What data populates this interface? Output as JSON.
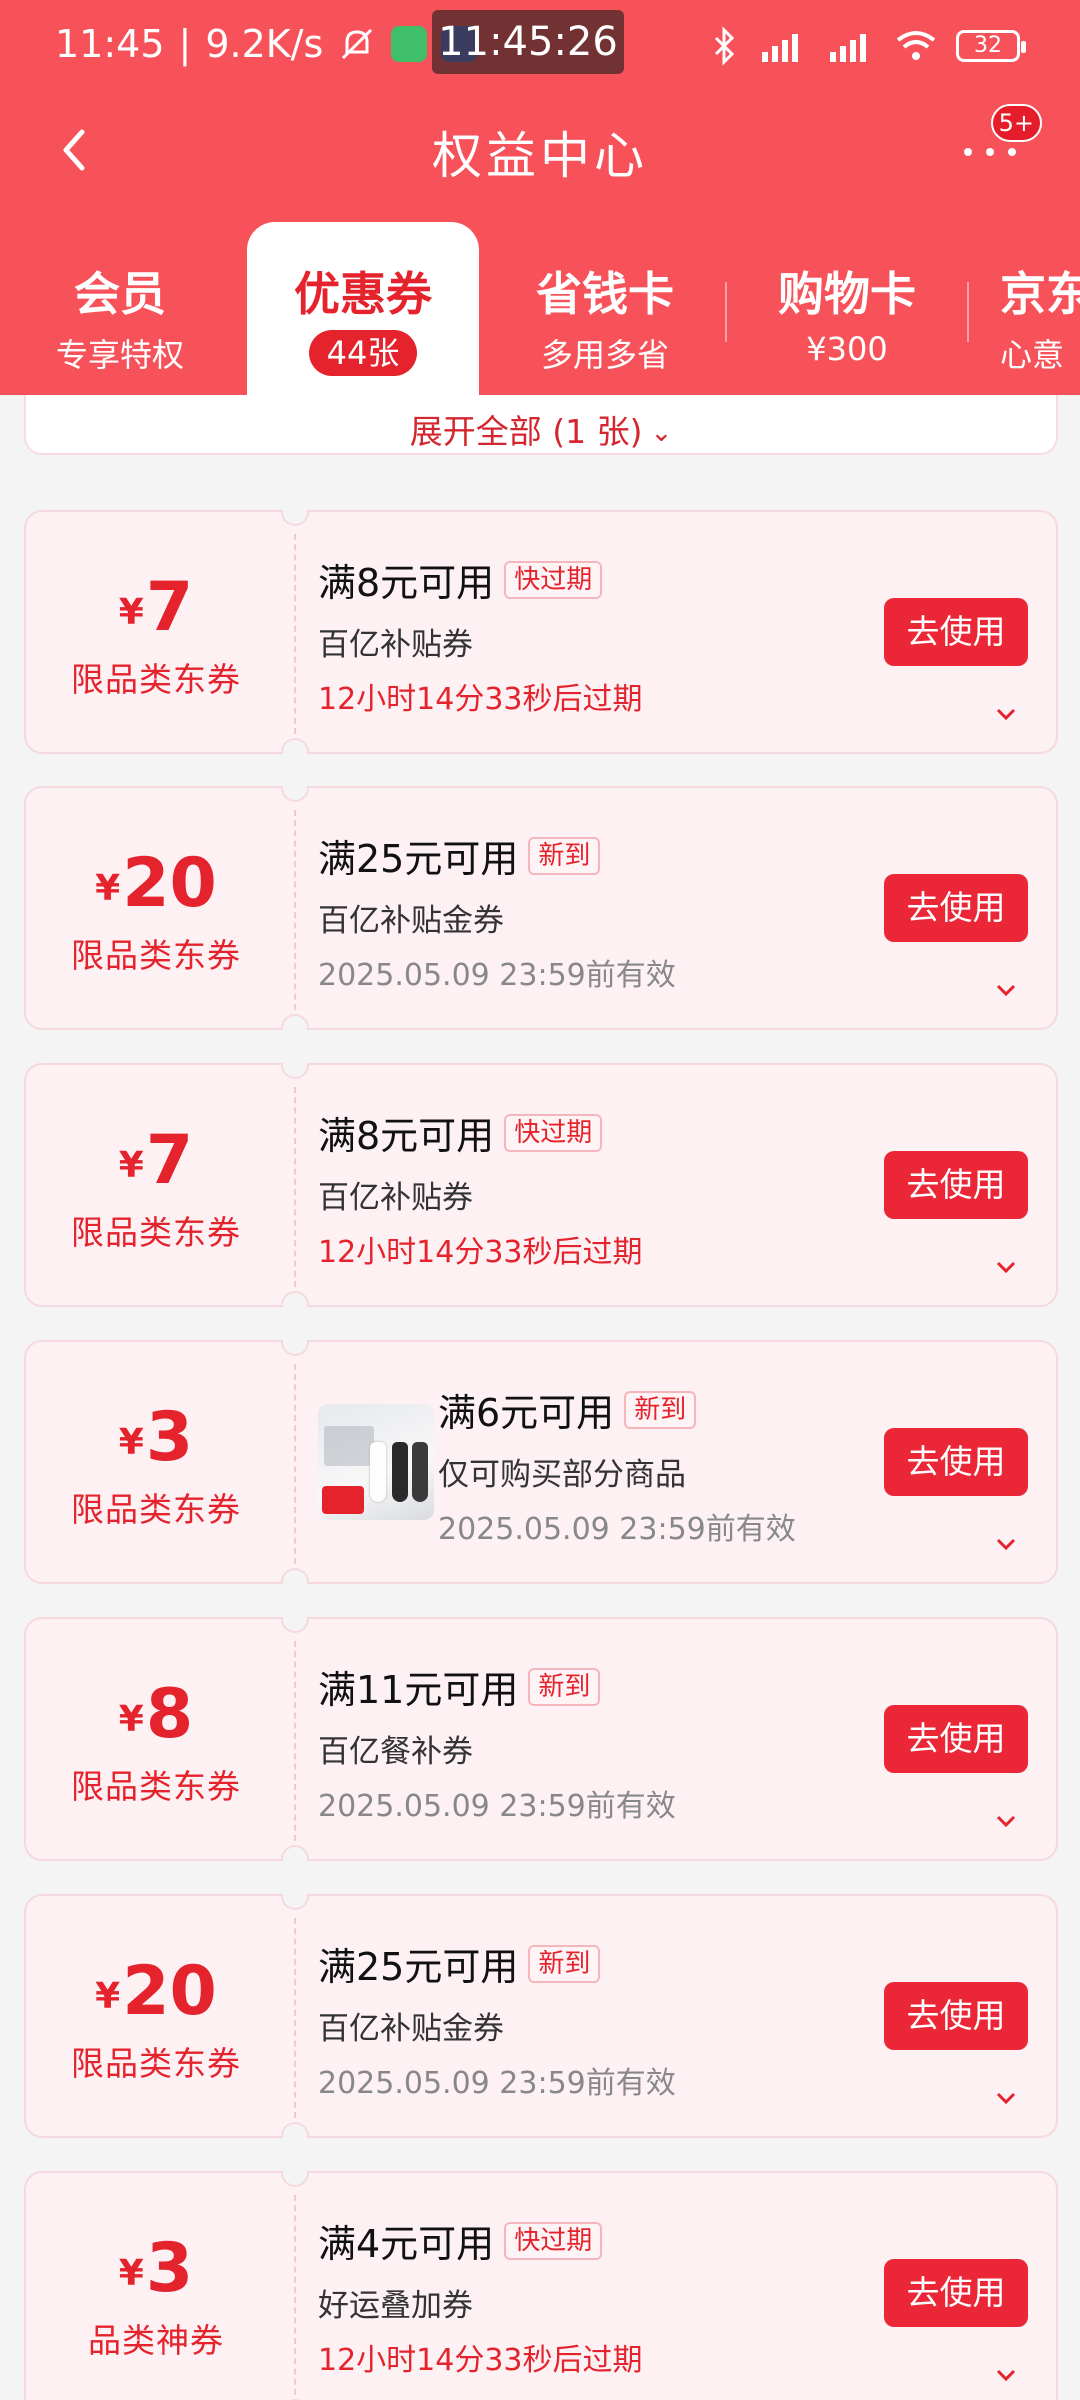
{
  "status_bar": {
    "time": "11:45",
    "speed": "9.2K/s",
    "clock_overlay": "11:45:26",
    "battery": "32",
    "icons": [
      "mute-icon",
      "app-icon",
      "alipay-icon",
      "bluetooth-icon",
      "signal-hd-icon",
      "wifi-icon"
    ]
  },
  "nav": {
    "title": "权益中心",
    "more_badge": "5+"
  },
  "tabs": [
    {
      "title": "会员",
      "sub": "专享特权"
    },
    {
      "title": "优惠券",
      "sub": "44张"
    },
    {
      "title": "省钱卡",
      "sub": "多用多省"
    },
    {
      "title": "购物卡",
      "sub": "¥300"
    },
    {
      "title": "京东",
      "sub": "心意"
    }
  ],
  "expand": {
    "label": "展开全部 (1 张)"
  },
  "coupons": [
    {
      "yen": "¥",
      "amount": "7",
      "type": "限品类东券",
      "condition": "满8元可用",
      "tag": "快过期",
      "desc": "百亿补贴券",
      "expiry": "12小时14分33秒后过期",
      "button": "去使用"
    },
    {
      "yen": "¥",
      "amount": "20",
      "type": "限品类东券",
      "condition": "满25元可用",
      "tag": "新到",
      "desc": "百亿补贴金券",
      "expiry": "2025.05.09 23:59前有效",
      "button": "去使用"
    },
    {
      "yen": "¥",
      "amount": "7",
      "type": "限品类东券",
      "condition": "满8元可用",
      "tag": "快过期",
      "desc": "百亿补贴券",
      "expiry": "12小时14分33秒后过期",
      "button": "去使用"
    },
    {
      "yen": "¥",
      "amount": "3",
      "type": "限品类东券",
      "condition": "满6元可用",
      "tag": "新到",
      "desc": "仅可购买部分商品",
      "expiry": "2025.05.09 23:59前有效",
      "button": "去使用"
    },
    {
      "yen": "¥",
      "amount": "8",
      "type": "限品类东券",
      "condition": "满11元可用",
      "tag": "新到",
      "desc": "百亿餐补券",
      "expiry": "2025.05.09 23:59前有效",
      "button": "去使用"
    },
    {
      "yen": "¥",
      "amount": "20",
      "type": "限品类东券",
      "condition": "满25元可用",
      "tag": "新到",
      "desc": "百亿补贴金券",
      "expiry": "2025.05.09 23:59前有效",
      "button": "去使用"
    },
    {
      "yen": "¥",
      "amount": "3",
      "type": "品类神券",
      "condition": "满4元可用",
      "tag": "快过期",
      "desc": "好运叠加券",
      "expiry": "12小时14分33秒后过期",
      "button": "去使用"
    }
  ],
  "colors": {
    "brand_red": "#f7525a",
    "accent_red": "#e5232d",
    "button_red": "#eb2636",
    "coupon_bg": "#fdf1f4"
  }
}
